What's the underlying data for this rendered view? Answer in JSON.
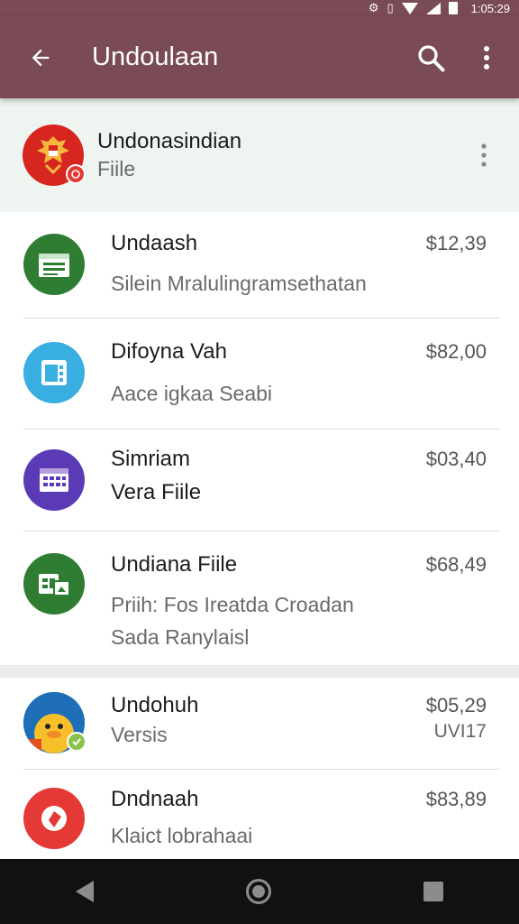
{
  "status_bar": {
    "time": "1:05:29"
  },
  "app_bar": {
    "title": "Undoulaan"
  },
  "highlighted": {
    "title": "Undonasindian",
    "subtitle": "Fiile"
  },
  "items": [
    {
      "title": "Undaash",
      "subtitle": "Silein Mralulingramsethatan",
      "price": "$12,39",
      "icon": "file-manager-icon",
      "color": "#2e7d32"
    },
    {
      "title": "Difoyna Vah",
      "subtitle": "Aace igkaa Seabi",
      "price": "$82,00",
      "icon": "tablet-app-icon",
      "color": "#39aee0"
    },
    {
      "title": "Simriam",
      "subtitle": "Vera Fiile",
      "price": "$03,40",
      "icon": "calendar-app-icon",
      "color": "#5b3bb5"
    },
    {
      "title": "Undiana Fiile",
      "subtitle": "Priih: Fos Ireatda Croadan",
      "subtitle2": "Sada Ranylaisl",
      "price": "$68,49",
      "icon": "files-app-icon",
      "color": "#2e7d32"
    },
    {
      "title": "Undohuh",
      "subtitle": "Versis",
      "price": "$05,29",
      "price_sub": "UVI17",
      "icon": "duck-avatar-icon",
      "color": "#1e6fb8"
    },
    {
      "title": "Dndnaah",
      "subtitle": "Klaict lobrahaai",
      "price": "$83,89",
      "icon": "red-app-icon",
      "color": "#e53935"
    }
  ]
}
